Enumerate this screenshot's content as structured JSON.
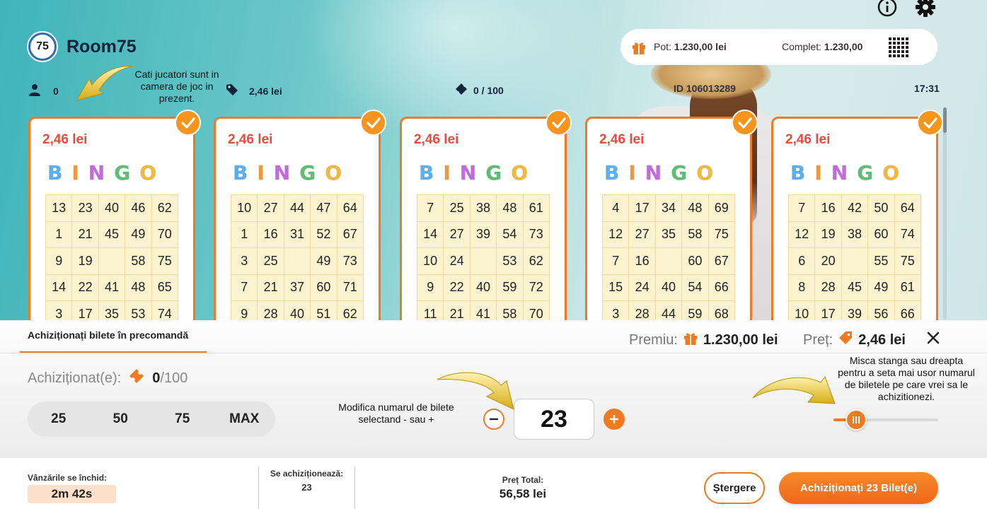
{
  "header": {
    "room_number": "75",
    "room_name": "Room75",
    "pot_label": "Pot:",
    "pot_value": "1.230,00 lei",
    "complet_label": "Complet:",
    "complet_value": "1.230,00",
    "players": "0",
    "ticket_price": "2,46 lei",
    "tickets_sold": "0 / 100",
    "game_id": "ID 106013289",
    "time": "17:31",
    "icons": [
      "info-icon",
      "gear-icon",
      "gift-icon",
      "grid-menu-icon",
      "user-icon",
      "price-tag-icon",
      "ticket-icon"
    ]
  },
  "hints": {
    "players_hint": "Cati jucatori sunt in camera de joc in prezent.",
    "stepper_hint": "Modifica numarul de bilete selectand - sau +",
    "slider_hint": "Misca stanga sau dreapta pentru a seta mai usor numarul de biletele pe care vrei sa le achizitionezi."
  },
  "bingo_letters": [
    "B",
    "I",
    "N",
    "G",
    "O"
  ],
  "bingo_colors": [
    "#5ab0f0",
    "#f29a3a",
    "#c46ae0",
    "#5cc072",
    "#f5b93a"
  ],
  "cards": [
    {
      "price": "2,46 lei",
      "rows": [
        [
          "13",
          "23",
          "40",
          "46",
          "62"
        ],
        [
          "1",
          "21",
          "45",
          "49",
          "70"
        ],
        [
          "9",
          "19",
          "",
          "58",
          "75"
        ],
        [
          "14",
          "22",
          "41",
          "48",
          "65"
        ],
        [
          "3",
          "17",
          "35",
          "53",
          "74"
        ]
      ]
    },
    {
      "price": "2,46 lei",
      "rows": [
        [
          "10",
          "27",
          "44",
          "47",
          "64"
        ],
        [
          "1",
          "16",
          "31",
          "52",
          "67"
        ],
        [
          "3",
          "25",
          "",
          "49",
          "73"
        ],
        [
          "7",
          "21",
          "37",
          "60",
          "71"
        ],
        [
          "9",
          "28",
          "40",
          "51",
          "62"
        ]
      ]
    },
    {
      "price": "2,46 lei",
      "rows": [
        [
          "7",
          "25",
          "38",
          "48",
          "61"
        ],
        [
          "14",
          "27",
          "39",
          "54",
          "73"
        ],
        [
          "10",
          "24",
          "",
          "53",
          "62"
        ],
        [
          "9",
          "22",
          "40",
          "59",
          "72"
        ],
        [
          "11",
          "21",
          "41",
          "58",
          "70"
        ]
      ]
    },
    {
      "price": "2,46 lei",
      "rows": [
        [
          "4",
          "17",
          "34",
          "48",
          "69"
        ],
        [
          "12",
          "27",
          "35",
          "58",
          "75"
        ],
        [
          "7",
          "16",
          "",
          "60",
          "67"
        ],
        [
          "15",
          "24",
          "40",
          "54",
          "66"
        ],
        [
          "3",
          "28",
          "44",
          "59",
          "68"
        ]
      ]
    },
    {
      "price": "2,46 lei",
      "rows": [
        [
          "7",
          "16",
          "42",
          "50",
          "64"
        ],
        [
          "12",
          "19",
          "38",
          "60",
          "74"
        ],
        [
          "6",
          "20",
          "",
          "55",
          "75"
        ],
        [
          "8",
          "28",
          "45",
          "49",
          "61"
        ],
        [
          "10",
          "17",
          "39",
          "56",
          "66"
        ]
      ]
    }
  ],
  "panel": {
    "tab_label": "Achiziționați bilete în precomandă",
    "premiu_label": "Premiu:",
    "premiu_value": "1.230,00 lei",
    "pret_label": "Preț:",
    "pret_value": "2,46 lei",
    "purchased_label": "Achiziționat(e):",
    "purchased_count": "0",
    "purchased_max": "/100",
    "quick_options": [
      "25",
      "50",
      "75",
      "MAX"
    ],
    "quantity": "23",
    "slider_fraction": 0.23
  },
  "footer": {
    "closes_label": "Vânzările se închid:",
    "countdown": "2m 42s",
    "buying_label": "Se achiziționează:",
    "buying_count": "23",
    "total_label": "Preț Total:",
    "total_value": "56,58 lei",
    "clear_label": "Ștergere",
    "buy_label": "Achiziționați 23 Bilet(e)"
  },
  "colors": {
    "accent": "#f07a22",
    "price_red": "#e84b3c",
    "card_cell": "#fbf3cf"
  }
}
